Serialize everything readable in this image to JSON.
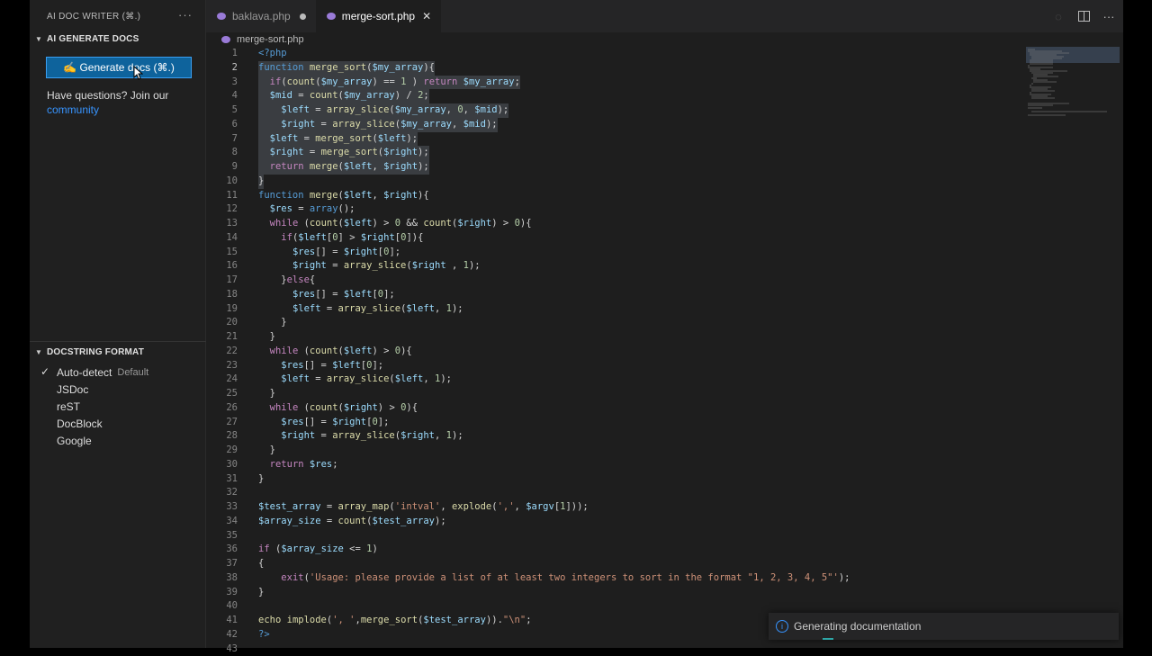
{
  "sidebar": {
    "title": "AI DOC WRITER (⌘.)",
    "section1_title": "AI GENERATE DOCS",
    "generate_button": "✍ Generate docs (⌘.)",
    "questions": "Have questions? Join our",
    "community_link": "community",
    "section2_title": "DOCSTRING FORMAT",
    "formats": [
      {
        "label": "Auto-detect",
        "badge": "Default",
        "checked": true
      },
      {
        "label": "JSDoc"
      },
      {
        "label": "reST"
      },
      {
        "label": "DocBlock"
      },
      {
        "label": "Google"
      }
    ]
  },
  "tabs": [
    {
      "label": "baklava.php",
      "dirty": true,
      "active": false
    },
    {
      "label": "merge-sort.php",
      "active": true
    }
  ],
  "breadcrumb": "merge-sort.php",
  "toast": {
    "message": "Generating documentation"
  },
  "current_line": 2,
  "code_lines": [
    {
      "n": "1",
      "html": "<span class='tg'>&lt;?php</span>"
    },
    {
      "n": "2",
      "sel": true,
      "html": "<span class='tg'>function</span> <span class='fn'>merge_sort</span>(<span class='vr'>$my_array</span>){"
    },
    {
      "n": "3",
      "sel": true,
      "html": "  <span class='kw'>if</span>(<span class='fn'>count</span>(<span class='vr'>$my_array</span>) == <span class='nm'>1</span> ) <span class='kw'>return</span> <span class='vr'>$my_array</span>;"
    },
    {
      "n": "4",
      "sel": true,
      "html": "  <span class='vr'>$mid</span> = <span class='fn'>count</span>(<span class='vr'>$my_array</span>) / <span class='nm'>2</span>;"
    },
    {
      "n": "5",
      "sel": true,
      "html": "    <span class='vr'>$left</span> = <span class='fn'>array_slice</span>(<span class='vr'>$my_array</span>, <span class='nm'>0</span>, <span class='vr'>$mid</span>);"
    },
    {
      "n": "6",
      "sel": true,
      "html": "    <span class='vr'>$right</span> = <span class='fn'>array_slice</span>(<span class='vr'>$my_array</span>, <span class='vr'>$mid</span>);"
    },
    {
      "n": "7",
      "sel": true,
      "html": "  <span class='vr'>$left</span> = <span class='fn'>merge_sort</span>(<span class='vr'>$left</span>);"
    },
    {
      "n": "8",
      "sel": true,
      "html": "  <span class='vr'>$right</span> = <span class='fn'>merge_sort</span>(<span class='vr'>$right</span>);"
    },
    {
      "n": "9",
      "sel": true,
      "html": "  <span class='kw'>return</span> <span class='fn'>merge</span>(<span class='vr'>$left</span>, <span class='vr'>$right</span>);"
    },
    {
      "n": "10",
      "sel": true,
      "html": "}"
    },
    {
      "n": "11",
      "html": "<span class='tg'>function</span> <span class='fn'>merge</span>(<span class='vr'>$left</span>, <span class='vr'>$right</span>){"
    },
    {
      "n": "12",
      "html": "  <span class='vr'>$res</span> = <span class='tg'>array</span>();"
    },
    {
      "n": "13",
      "html": "  <span class='kw'>while</span> (<span class='fn'>count</span>(<span class='vr'>$left</span>) &gt; <span class='nm'>0</span> &amp;&amp; <span class='fn'>count</span>(<span class='vr'>$right</span>) &gt; <span class='nm'>0</span>){"
    },
    {
      "n": "14",
      "html": "    <span class='kw'>if</span>(<span class='vr'>$left</span>[<span class='nm'>0</span>] &gt; <span class='vr'>$right</span>[<span class='nm'>0</span>]){"
    },
    {
      "n": "15",
      "html": "      <span class='vr'>$res</span>[] = <span class='vr'>$right</span>[<span class='nm'>0</span>];"
    },
    {
      "n": "16",
      "html": "      <span class='vr'>$right</span> = <span class='fn'>array_slice</span>(<span class='vr'>$right</span> , <span class='nm'>1</span>);"
    },
    {
      "n": "17",
      "html": "    }<span class='kw'>else</span>{"
    },
    {
      "n": "18",
      "html": "      <span class='vr'>$res</span>[] = <span class='vr'>$left</span>[<span class='nm'>0</span>];"
    },
    {
      "n": "19",
      "html": "      <span class='vr'>$left</span> = <span class='fn'>array_slice</span>(<span class='vr'>$left</span>, <span class='nm'>1</span>);"
    },
    {
      "n": "20",
      "html": "    }"
    },
    {
      "n": "21",
      "html": "  }"
    },
    {
      "n": "22",
      "html": "  <span class='kw'>while</span> (<span class='fn'>count</span>(<span class='vr'>$left</span>) &gt; <span class='nm'>0</span>){"
    },
    {
      "n": "23",
      "html": "    <span class='vr'>$res</span>[] = <span class='vr'>$left</span>[<span class='nm'>0</span>];"
    },
    {
      "n": "24",
      "html": "    <span class='vr'>$left</span> = <span class='fn'>array_slice</span>(<span class='vr'>$left</span>, <span class='nm'>1</span>);"
    },
    {
      "n": "25",
      "html": "  }"
    },
    {
      "n": "26",
      "html": "  <span class='kw'>while</span> (<span class='fn'>count</span>(<span class='vr'>$right</span>) &gt; <span class='nm'>0</span>){"
    },
    {
      "n": "27",
      "html": "    <span class='vr'>$res</span>[] = <span class='vr'>$right</span>[<span class='nm'>0</span>];"
    },
    {
      "n": "28",
      "html": "    <span class='vr'>$right</span> = <span class='fn'>array_slice</span>(<span class='vr'>$right</span>, <span class='nm'>1</span>);"
    },
    {
      "n": "29",
      "html": "  }"
    },
    {
      "n": "30",
      "html": "  <span class='kw'>return</span> <span class='vr'>$res</span>;"
    },
    {
      "n": "31",
      "html": "}"
    },
    {
      "n": "32",
      "html": ""
    },
    {
      "n": "33",
      "html": "<span class='vr'>$test_array</span> = <span class='fn'>array_map</span>(<span class='st'>'intval'</span>, <span class='fn'>explode</span>(<span class='st'>','</span>, <span class='vr'>$argv</span>[<span class='nm'>1</span>]));"
    },
    {
      "n": "34",
      "html": "<span class='vr'>$array_size</span> = <span class='fn'>count</span>(<span class='vr'>$test_array</span>);"
    },
    {
      "n": "35",
      "html": ""
    },
    {
      "n": "36",
      "html": "<span class='kw'>if</span> (<span class='vr'>$array_size</span> &lt;= <span class='nm'>1</span>)"
    },
    {
      "n": "37",
      "html": "{"
    },
    {
      "n": "38",
      "html": "    <span class='kw'>exit</span>(<span class='st'>'Usage: please provide a list of at least two integers to sort in the format \"1, 2, 3, 4, 5\"'</span>);"
    },
    {
      "n": "39",
      "html": "}"
    },
    {
      "n": "40",
      "html": ""
    },
    {
      "n": "41",
      "html": "<span class='fn'>echo</span> <span class='fn'>implode</span>(<span class='st'>', '</span>,<span class='fn'>merge_sort</span>(<span class='vr'>$test_array</span>)).<span class='st'>\"\\n\"</span>;"
    },
    {
      "n": "42",
      "html": "<span class='tg'>?&gt;</span>"
    },
    {
      "n": "43",
      "html": ""
    }
  ]
}
